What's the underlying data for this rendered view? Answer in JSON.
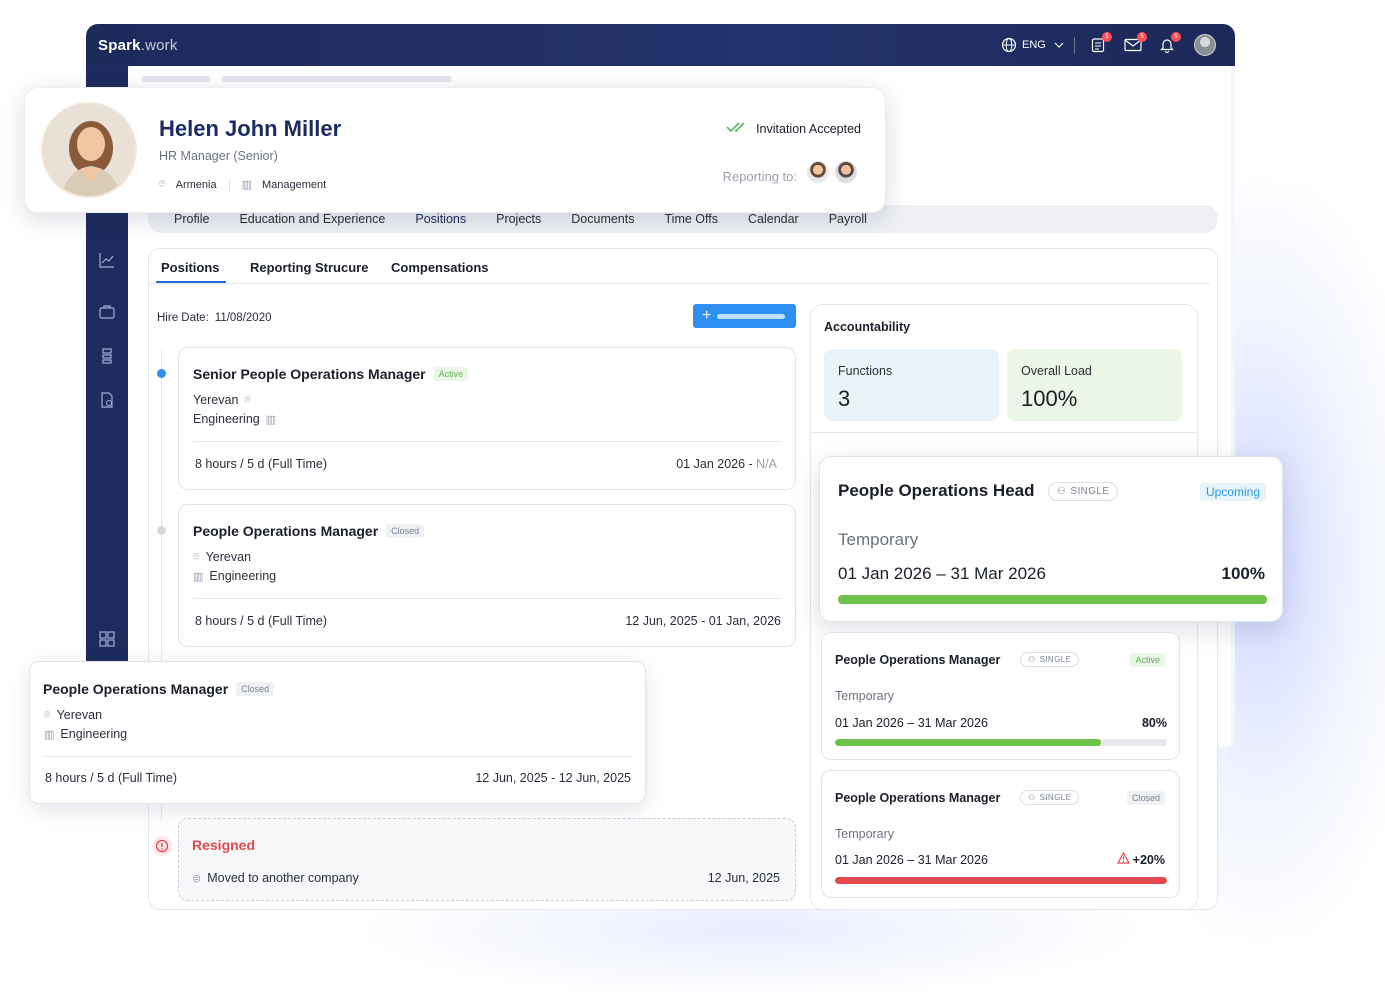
{
  "app": {
    "logo_main": "Spark",
    "logo_suffix": ".work",
    "language": "ENG",
    "notifications": {
      "tasks": "5",
      "messages": "5",
      "alerts": "5"
    }
  },
  "profile": {
    "name": "Helen John Miller",
    "role": "HR Manager (Senior)",
    "location": "Armenia",
    "department": "Management",
    "invitation_status": "Invitation Accepted",
    "reporting_label": "Reporting to:"
  },
  "tabs": [
    "Profile",
    "Education and Experience",
    "Positions",
    "Projects",
    "Documents",
    "Time Offs",
    "Calendar",
    "Payroll"
  ],
  "subtabs": [
    "Positions",
    "Reporting Strucure",
    "Compensations"
  ],
  "hire": {
    "label": "Hire Date:",
    "value": "11/08/2020"
  },
  "positions": [
    {
      "title": "Senior People Operations Manager",
      "status": "Active",
      "city": "Yerevan",
      "dept": "Engineering",
      "hours": "8 hours / 5 d  (Full Time)",
      "start": "01 Jan 2026 - ",
      "end": "N/A"
    },
    {
      "title": "People Operations Manager",
      "status": "Closed",
      "city": "Yerevan",
      "dept": "Engineering",
      "hours": "8 hours / 5 d  (Full Time)",
      "period": "12 Jun, 2025 - 01 Jan, 2026"
    },
    {
      "title": "People Operations Manager",
      "status": "Closed",
      "city": "Yerevan",
      "dept": "Engineering",
      "hours": "8 hours / 5 d  (Full Time)",
      "period": "12 Jun, 2025 - 12 Jun, 2025"
    }
  ],
  "resigned": {
    "title": "Resigned",
    "reason": "Moved to another company",
    "date": "12 Jun, 2025"
  },
  "accountability": {
    "title": "Accountability",
    "functions_label": "Functions",
    "functions_value": "3",
    "load_label": "Overall Load",
    "load_value": "100%",
    "items": [
      {
        "title": "People Operations Head",
        "type": "SINGLE",
        "status": "Upcoming",
        "kind": "Temporary",
        "period": "01 Jan 2026 – 31 Mar 2026",
        "percent": "100%",
        "load": 100,
        "color": "#6cc24a"
      },
      {
        "title": "People Operations Manager",
        "type": "SINGLE",
        "status": "Active",
        "kind": "Temporary",
        "period": "01 Jan 2026 – 31 Mar 2026",
        "percent": "80%",
        "load": 80,
        "color": "#6cc24a"
      },
      {
        "title": "People Operations Manager",
        "type": "SINGLE",
        "status": "Closed",
        "kind": "Temporary",
        "period": "01 Jan 2026 – 31 Mar 2026",
        "percent": "+20%",
        "load": 100,
        "color": "#e5484d"
      }
    ]
  }
}
